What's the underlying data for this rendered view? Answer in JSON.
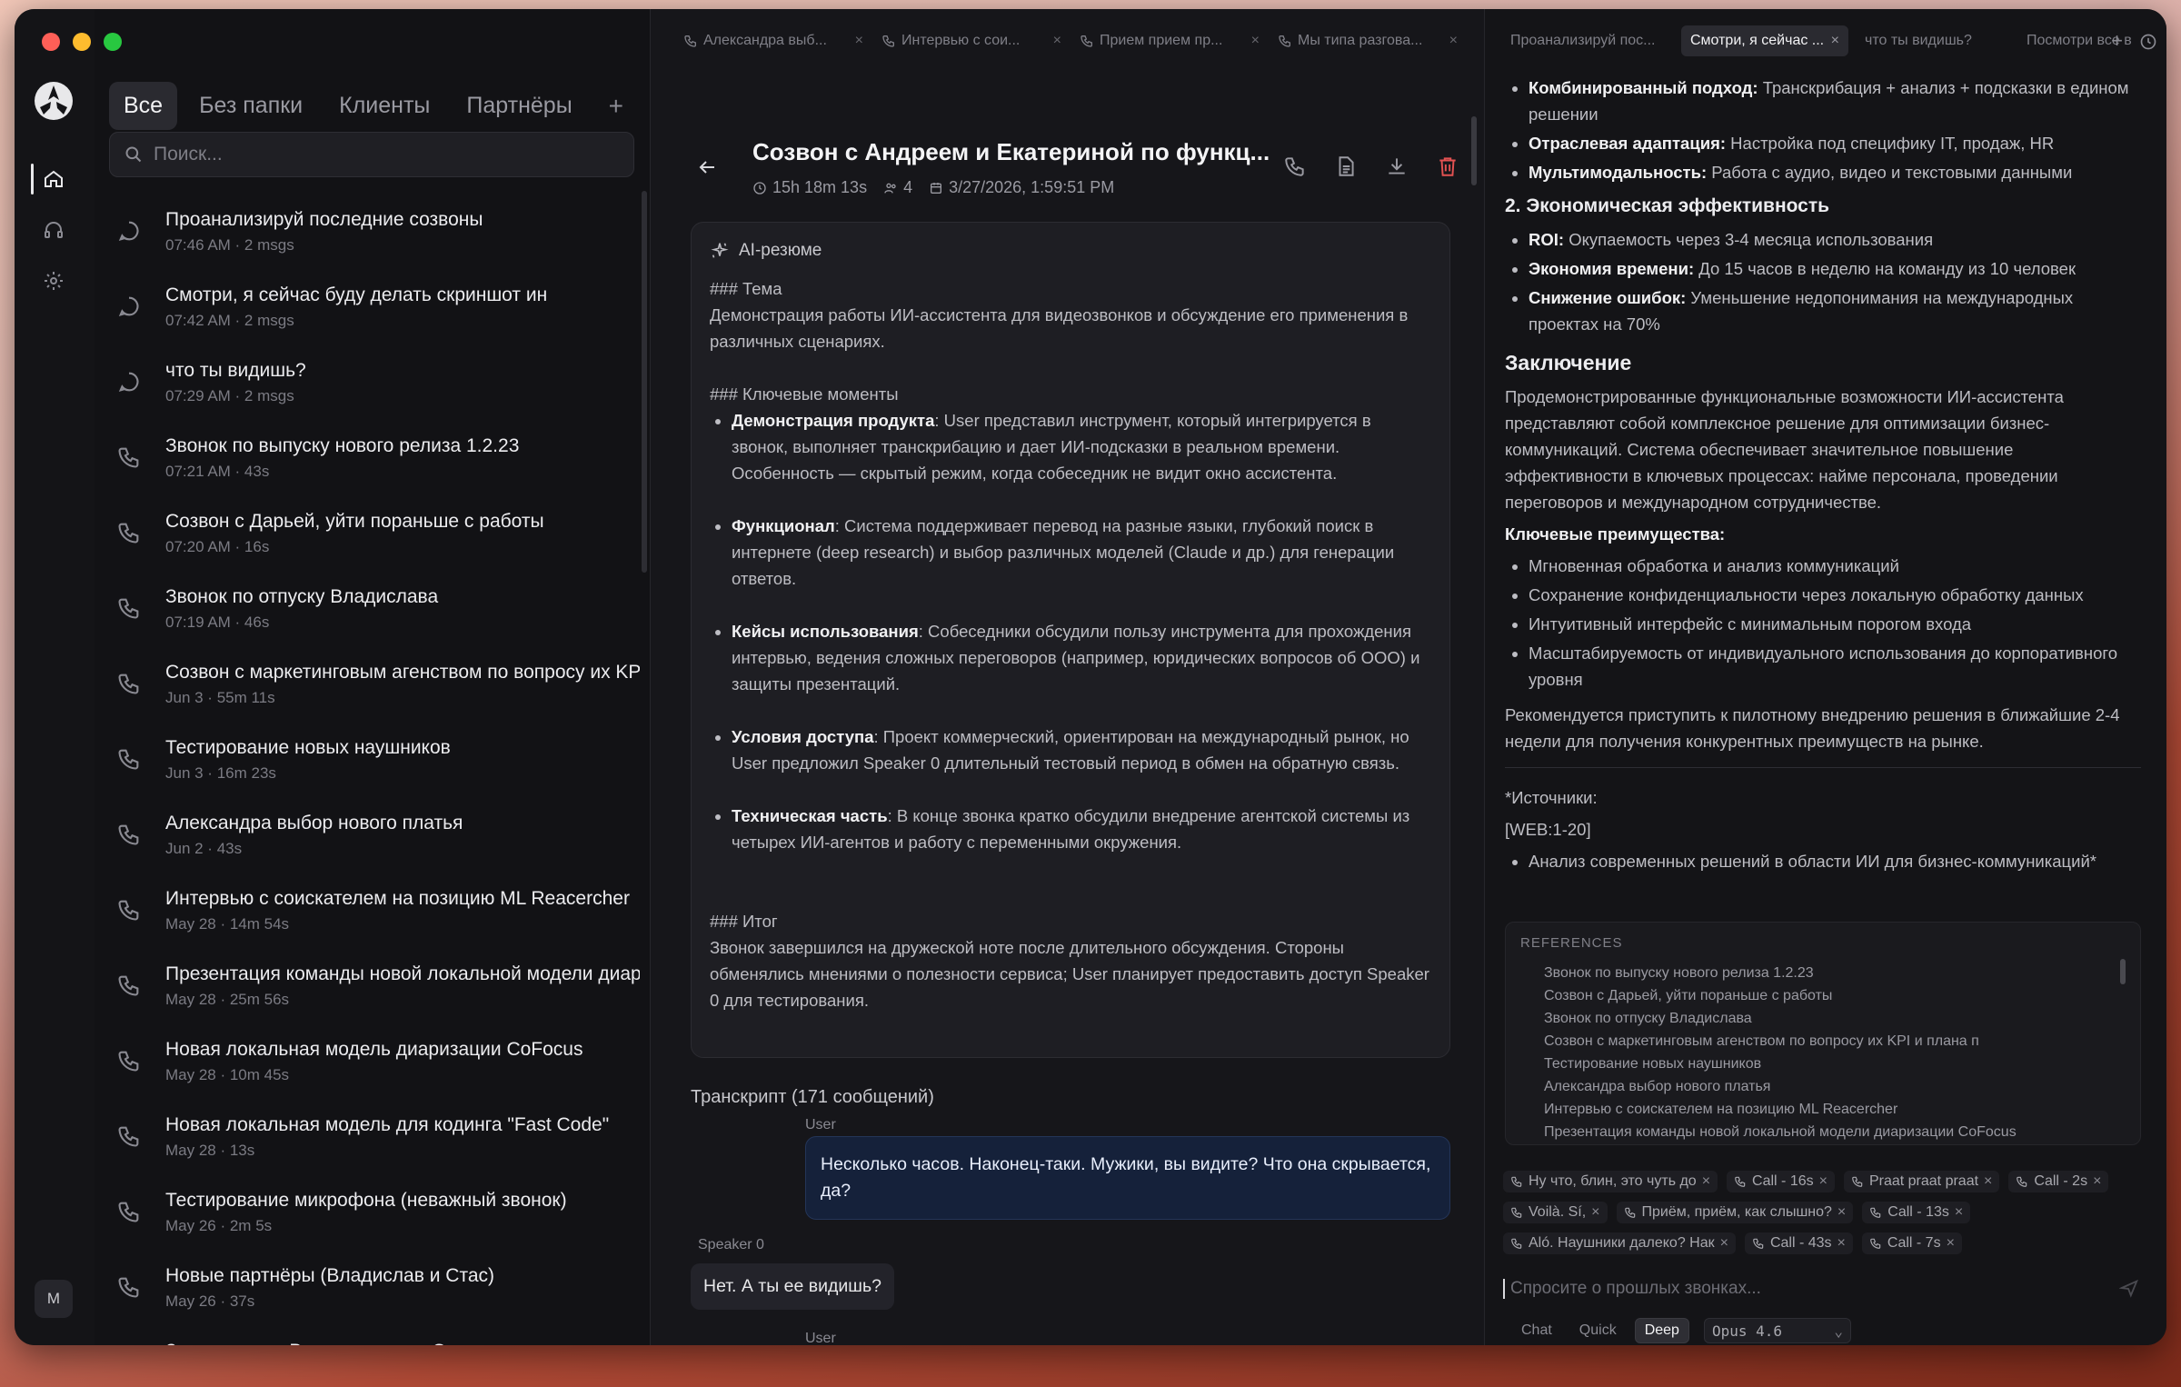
{
  "sidebar": {
    "folders": [
      "Все",
      "Без папки",
      "Клиенты",
      "Партнёры"
    ],
    "folder_add": "+",
    "search_placeholder": "Поиск...",
    "conversations": [
      {
        "title": "Проанализируй последние созвоны",
        "meta": "07:46 AM · 2 msgs",
        "icon": "chat-bubble-icon"
      },
      {
        "title": "Смотри, я сейчас буду делать скриншот ин",
        "meta": "07:42 AM · 2 msgs",
        "icon": "chat-bubble-icon"
      },
      {
        "title": "что ты видишь?",
        "meta": "07:29 AM · 2 msgs",
        "icon": "chat-bubble-icon"
      },
      {
        "title": "Звонок по выпуску нового релиза 1.2.23",
        "meta": "07:21 AM · 43s",
        "icon": "phone-icon"
      },
      {
        "title": "Созвон с Дарьей, уйти пораньше с работы",
        "meta": "07:20 AM · 16s",
        "icon": "phone-icon"
      },
      {
        "title": "Звонок по отпуску Владислава",
        "meta": "07:19 AM · 46s",
        "icon": "phone-icon"
      },
      {
        "title": "Созвон с маркетинговым агенством по вопросу их KP",
        "meta": "Jun 3 · 55m 11s",
        "icon": "phone-icon"
      },
      {
        "title": "Тестирование новых наушников",
        "meta": "Jun 3 · 16m 23s",
        "icon": "phone-icon"
      },
      {
        "title": "Александра выбор нового платья",
        "meta": "Jun 2 · 43s",
        "icon": "phone-icon"
      },
      {
        "title": "Интервью с соискателем на позицию ML Reacercher",
        "meta": "May 28 · 14m 54s",
        "icon": "phone-icon"
      },
      {
        "title": "Презентация команды новой локальной модели диари",
        "meta": "May 28 · 25m 56s",
        "icon": "phone-icon"
      },
      {
        "title": "Новая локальная модель диаризации CoFocus",
        "meta": "May 28 · 10m 45s",
        "icon": "phone-icon"
      },
      {
        "title": "Новая локальная модель для кодинга \"Fast Code\"",
        "meta": "May 28 · 13s",
        "icon": "phone-icon"
      },
      {
        "title": "Тестирование микрофона (неважный звонок)",
        "meta": "May 26 · 2m 5s",
        "icon": "phone-icon"
      },
      {
        "title": "Новые партнёры (Владислав и Стас)",
        "meta": "May 26 · 37s",
        "icon": "phone-icon"
      },
      {
        "title": "Знакомство с Владиславом и Стасом",
        "meta": "",
        "icon": "phone-icon"
      }
    ]
  },
  "rail": {
    "avatar_initial": "M"
  },
  "middle": {
    "tabs": [
      "Александра выб...",
      "Интервью с сои...",
      "Прием прием пр...",
      "Мы типа разгова..."
    ],
    "title": "Созвон с Андреем и Екатериной по функц...",
    "duration": "15h 18m 13s",
    "participants": "4",
    "date": "3/27/2026, 1:59:51 PM",
    "summary_label": "AI-резюме",
    "summary": {
      "topic_heading": "### Тема",
      "topic_text": "Демонстрация работы ИИ-ассистента для видеозвонков и обсуждение его применения в различных сценариях.",
      "moments_heading": "### Ключевые моменты",
      "moments": [
        {
          "bold": "Демонстрация продукта",
          "text": ": User представил инструмент, который интегрируется в звонок, выполняет транскрибацию и дает ИИ-подсказки в реальном времени. Особенность — скрытый режим, когда собеседник не видит окно ассистента."
        },
        {
          "bold": "Функционал",
          "text": ": Система поддерживает перевод на разные языки, глубокий поиск в интернете (deep research) и выбор различных моделей (Claude и др.) для генерации ответов."
        },
        {
          "bold": "Кейсы использования",
          "text": ": Собеседники обсудили пользу инструмента для прохождения интервью, ведения сложных переговоров (например, юридических вопросов об ООО) и защиты презентаций."
        },
        {
          "bold": "Условия доступа",
          "text": ": Проект коммерческий, ориентирован на международный рынок, но User предложил Speaker 0 длительный тестовый период в обмен на обратную связь."
        },
        {
          "bold": "Техническая часть",
          "text": ": В конце звонка кратко обсудили внедрение агентской системы из четырех ИИ-агентов и работу с переменными окружения."
        }
      ],
      "result_heading": "### Итог",
      "result_text": "Звонок завершился на дружеской ноте после длительного обсуждения. Стороны обменялись мнениями о полезности сервиса; User планирует предоставить доступ Speaker 0 для тестирования."
    },
    "transcript_title": "Транскрипт (171 сообщений)",
    "messages": [
      {
        "speaker": "User",
        "text": "Несколько часов. Наконец-таки. Мужики, вы видите? Что она скрывается, да?"
      },
      {
        "speaker": "Speaker 0",
        "text": "Нет. А ты ее видишь?"
      },
      {
        "speaker": "User",
        "text": ""
      }
    ]
  },
  "right": {
    "tabs": [
      "Проанализируй пос...",
      "Смотри, я сейчас ...",
      "что ты видишь?",
      "Посмотри все в"
    ],
    "tab_close": "×",
    "tab_add": "+",
    "top_cut": {
      "bold": "Комбинированный подход:",
      "text": " Транскрибация + анализ + подсказки в едином решении"
    },
    "list1": [
      {
        "bold": "Отраслевая адаптация:",
        "text": " Настройка под специфику IT, продаж, HR"
      },
      {
        "bold": "Мультимодальность:",
        "text": " Работа с аудио, видео и текстовыми данными"
      }
    ],
    "econ_heading": "2. Экономическая эффективность",
    "econ_items": [
      {
        "bold": "ROI:",
        "text": " Окупаемость через 3-4 месяца использования"
      },
      {
        "bold": "Экономия времени:",
        "text": " До 15 часов в неделю на команду из 10 человек"
      },
      {
        "bold": "Снижение ошибок:",
        "text": " Уменьшение недопонимания на международных проектах на 70%"
      }
    ],
    "conclusion_heading": "Заключение",
    "conclusion_text": "Продемонстрированные функциональные возможности ИИ-ассистента представляют собой комплексное решение для оптимизации бизнес-коммуникаций. Система обеспечивает значительное повышение эффективности в ключевых процессах: найме персонала, проведении переговоров и международном сотрудничестве.",
    "advantages_heading": "Ключевые преимущества:",
    "advantages": [
      "Мгновенная обработка и анализ коммуникаций",
      "Сохранение конфиденциальности через локальную обработку данных",
      "Интуитивный интерфейс с минимальным порогом входа",
      "Масштабируемость от индивидуального использования до корпоративного уровня"
    ],
    "recommendation": "Рекомендуется приступить к пилотному внедрению решения в ближайшие 2-4 недели для получения конкурентных преимуществ на рынке.",
    "sources_label": "*Источники:",
    "sources_ref": "[WEB:1-20]",
    "sources_item": "Анализ современных решений в области ИИ для бизнес-коммуникаций*",
    "references_title": "REFERENCES",
    "references": [
      "Звонок по выпуску нового релиза 1.2.23",
      "Созвон с Дарьей, уйти пораньше с работы",
      "Звонок по отпуску Владислава",
      "Созвон с маркетинговым агенством по вопросу их KPI и плана п",
      "Тестирование новых наушников",
      "Александра выбор нового платья",
      "Интервью с соискателем на позицию ML Reacercher",
      "Презентация команды новой локальной модели диаризации CoFocus"
    ],
    "chips": [
      "Ну что, блин, это чуть до",
      "Call - 16s",
      "Praat praat praat",
      "Call - 2s",
      "Voilà. Sí,",
      "Приём, приём, как слышно?",
      "Call - 13s",
      "Aló. Наушники далеко? Нак",
      "Call - 43s",
      "Call - 7s"
    ],
    "ask_placeholder": "Спросите о прошлых звонках...",
    "modes": [
      "Chat",
      "Quick",
      "Deep"
    ],
    "active_mode": "Deep",
    "model": "Opus 4.6"
  }
}
